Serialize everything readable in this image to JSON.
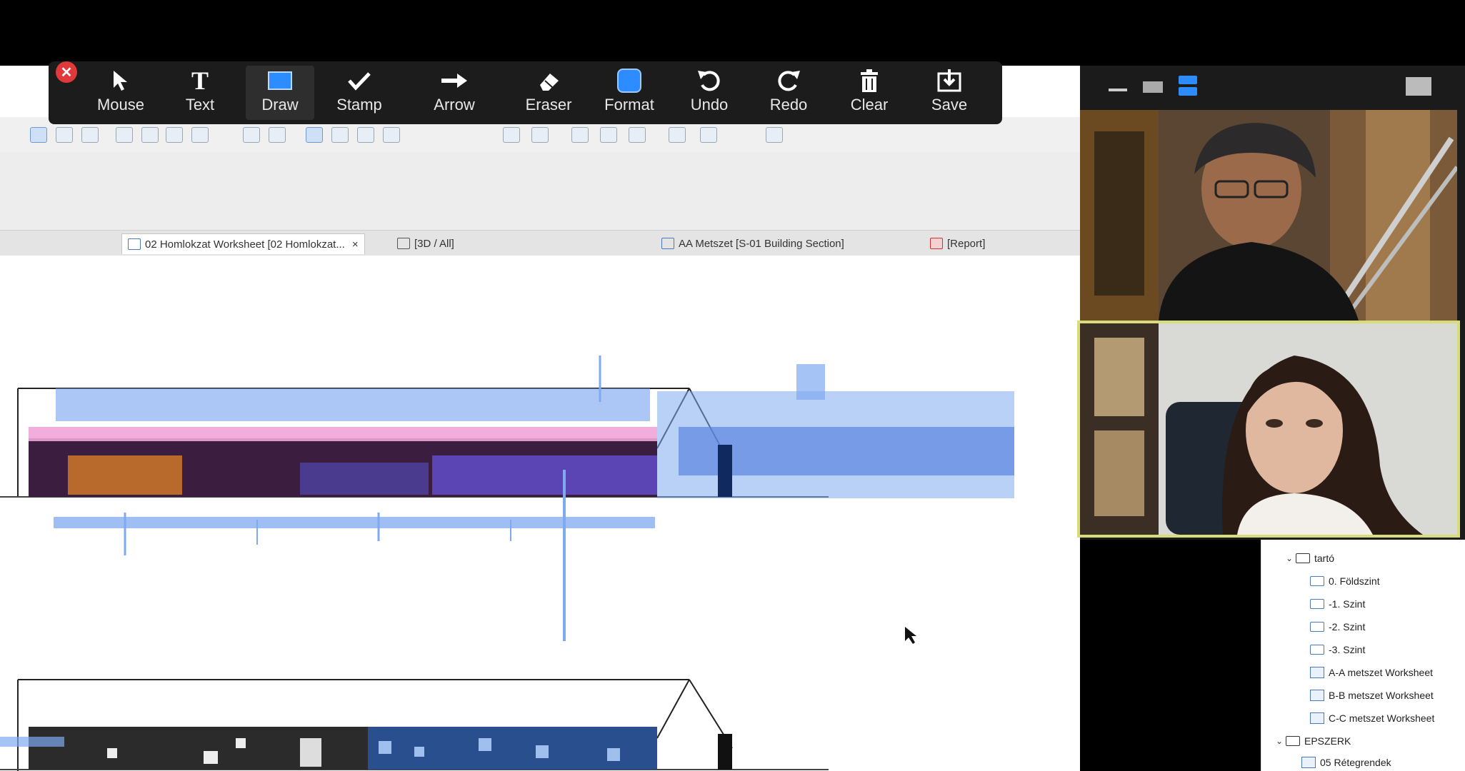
{
  "annotation_toolbar": {
    "close_label": "✕",
    "tools": [
      {
        "label": "Mouse",
        "icon": "mouse-pointer-icon"
      },
      {
        "label": "Text",
        "icon": "text-icon"
      },
      {
        "label": "Draw",
        "icon": "draw-rect-icon"
      },
      {
        "label": "Stamp",
        "icon": "checkmark-icon"
      },
      {
        "label": "Arrow",
        "icon": "arrow-right-icon"
      },
      {
        "label": "Eraser",
        "icon": "eraser-icon"
      },
      {
        "label": "Format",
        "icon": "format-swatch-icon"
      },
      {
        "label": "Undo",
        "icon": "undo-icon"
      },
      {
        "label": "Redo",
        "icon": "redo-icon"
      },
      {
        "label": "Clear",
        "icon": "trash-icon"
      },
      {
        "label": "Save",
        "icon": "save-download-icon"
      }
    ],
    "active_tool": "Draw",
    "format_color": "#2d8cff"
  },
  "tabs": [
    {
      "label": "02 Homlokzat Worksheet [02 Homlokzat...",
      "close": "×",
      "active": true
    },
    {
      "label": "[3D / All]"
    },
    {
      "label": "AA Metszet [S-01 Building Section]"
    },
    {
      "label": "[Report]"
    }
  ],
  "navigator": {
    "items": [
      {
        "label": "tartó",
        "type": "folder",
        "expanded": true
      },
      {
        "label": "0. Földszint",
        "type": "folder"
      },
      {
        "label": "-1. Szint",
        "type": "folder"
      },
      {
        "label": "-2. Szint",
        "type": "folder"
      },
      {
        "label": "-3. Szint",
        "type": "folder"
      },
      {
        "label": "A-A metszet Worksheet",
        "type": "sheet"
      },
      {
        "label": "B-B metszet Worksheet",
        "type": "sheet"
      },
      {
        "label": "C-C metszet Worksheet",
        "type": "sheet"
      },
      {
        "label": "EPSZERK",
        "type": "folder",
        "expanded": true
      },
      {
        "label": "05 Rétegrendek",
        "type": "sheet"
      }
    ]
  },
  "video_panel": {
    "controls": [
      "minimize-icon",
      "thumbnail-view-icon",
      "speaker-view-icon",
      "layout-toggle-icon"
    ],
    "active_speaker_color": "#d6dd7a"
  },
  "colors": {
    "highlight_blue": "#7fa9f0",
    "highlight_pink": "#f0a5d8",
    "building_dark": "#2b2b2b",
    "building_purple": "#5b2a6e",
    "building_blue": "#2a4f8f"
  }
}
